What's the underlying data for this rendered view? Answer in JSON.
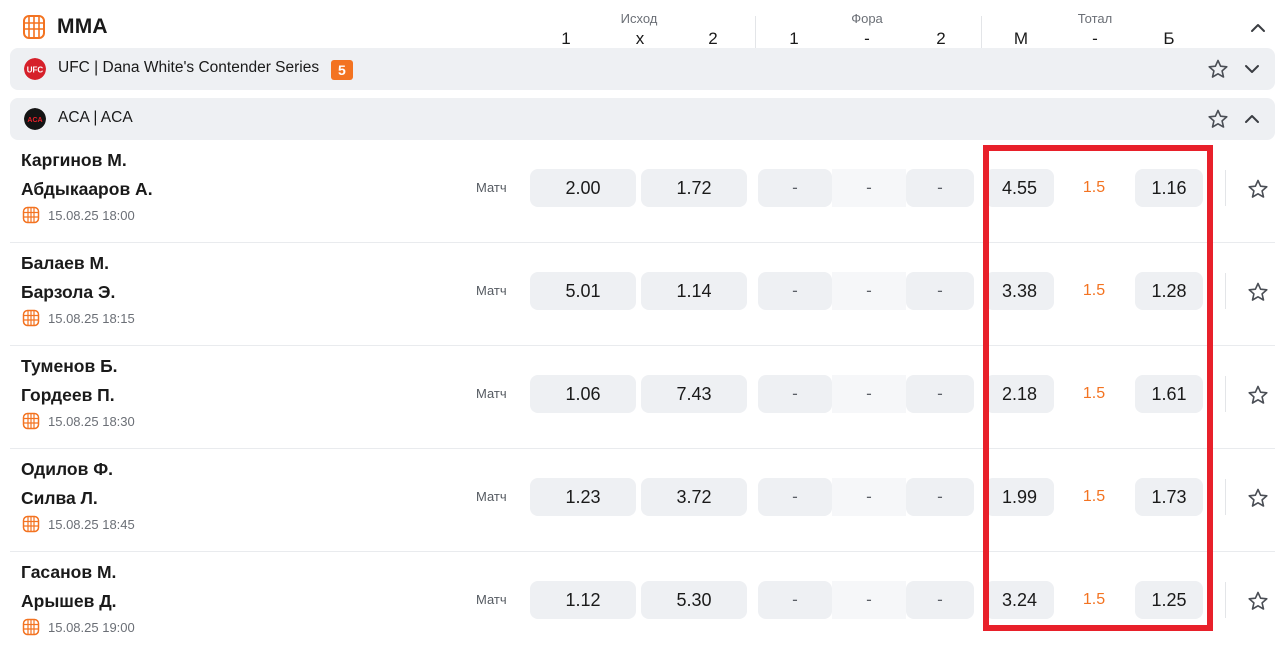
{
  "header": {
    "sport_title": "MMA",
    "groups": [
      {
        "label": "Исход",
        "columns": [
          "1",
          "x",
          "2"
        ]
      },
      {
        "label": "Фора",
        "columns": [
          "1",
          "-",
          "2"
        ]
      },
      {
        "label": "Тотал",
        "columns": [
          "М",
          "-",
          "Б"
        ]
      }
    ]
  },
  "leagues": [
    {
      "name": "UFC | Dana White's Contender Series",
      "count": "5",
      "logo_text": "UFC"
    },
    {
      "name": "ACA | ACA",
      "logo_text": "ACA"
    }
  ],
  "events": [
    {
      "team1": "Каргинов М.",
      "team2": "Абдыкааров А.",
      "date": "15.08.25 18:00",
      "market": "Матч",
      "odds": {
        "w1": "2.00",
        "w2": "1.72",
        "h1": "-",
        "hp": "-",
        "h2": "-",
        "tm": "4.55",
        "tp": "1.5",
        "tb": "1.16"
      }
    },
    {
      "team1": "Балаев М.",
      "team2": "Барзола Э.",
      "date": "15.08.25 18:15",
      "market": "Матч",
      "odds": {
        "w1": "5.01",
        "w2": "1.14",
        "h1": "-",
        "hp": "-",
        "h2": "-",
        "tm": "3.38",
        "tp": "1.5",
        "tb": "1.28"
      }
    },
    {
      "team1": "Туменов Б.",
      "team2": "Гордеев П.",
      "date": "15.08.25 18:30",
      "market": "Матч",
      "odds": {
        "w1": "1.06",
        "w2": "7.43",
        "h1": "-",
        "hp": "-",
        "h2": "-",
        "tm": "2.18",
        "tp": "1.5",
        "tb": "1.61"
      }
    },
    {
      "team1": "Одилов Ф.",
      "team2": "Силва Л.",
      "date": "15.08.25 18:45",
      "market": "Матч",
      "odds": {
        "w1": "1.23",
        "w2": "3.72",
        "h1": "-",
        "hp": "-",
        "h2": "-",
        "tm": "1.99",
        "tp": "1.5",
        "tb": "1.73"
      }
    },
    {
      "team1": "Гасанов М.",
      "team2": "Арышев Д.",
      "date": "15.08.25 19:00",
      "market": "Матч",
      "odds": {
        "w1": "1.12",
        "w2": "5.30",
        "h1": "-",
        "hp": "-",
        "h2": "-",
        "tm": "3.24",
        "tp": "1.5",
        "tb": "1.25"
      }
    }
  ],
  "colors": {
    "accent": "#f37321",
    "highlight": "#e8202a",
    "cell_bg": "#eef0f3"
  },
  "icons": {
    "sport": "mma-cage-icon",
    "date": "cage-calendar-icon",
    "favorite": "star-outline-icon",
    "collapse": "chevron-up-icon",
    "expand": "chevron-down-icon"
  }
}
